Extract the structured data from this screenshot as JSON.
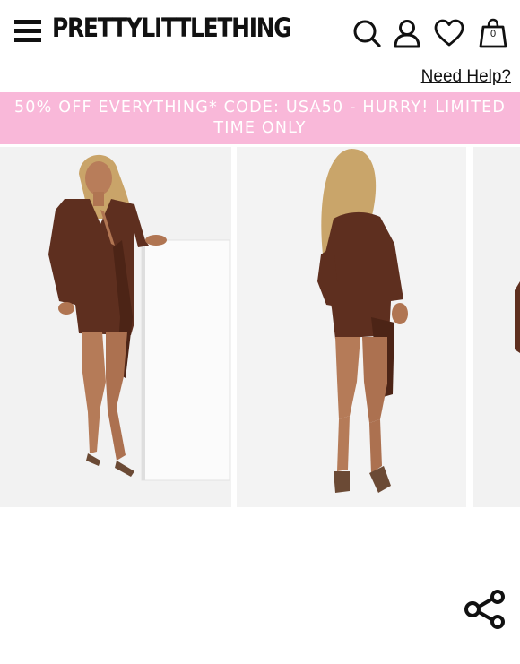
{
  "header": {
    "menu_icon": "hamburger-menu-icon",
    "logo_text": "PRETTYLITTLETHING",
    "search_icon": "search-icon",
    "account_icon": "user-icon",
    "wishlist_icon": "heart-icon",
    "bag_icon": "shopping-bag-icon",
    "bag_count": "0",
    "help_link": "Need Help?"
  },
  "banner": {
    "text": "50% OFF EVERYTHING* CODE: USA50 - HURRY! LIMITED TIME ONLY",
    "background": "#f9b8d9",
    "color": "#ffffff"
  },
  "gallery": {
    "images": [
      {
        "name": "front-view",
        "dress_color": "#5e2f1f"
      },
      {
        "name": "back-view",
        "dress_color": "#5e2f1f"
      },
      {
        "name": "next-image-peek"
      }
    ],
    "share_icon": "share-icon"
  }
}
